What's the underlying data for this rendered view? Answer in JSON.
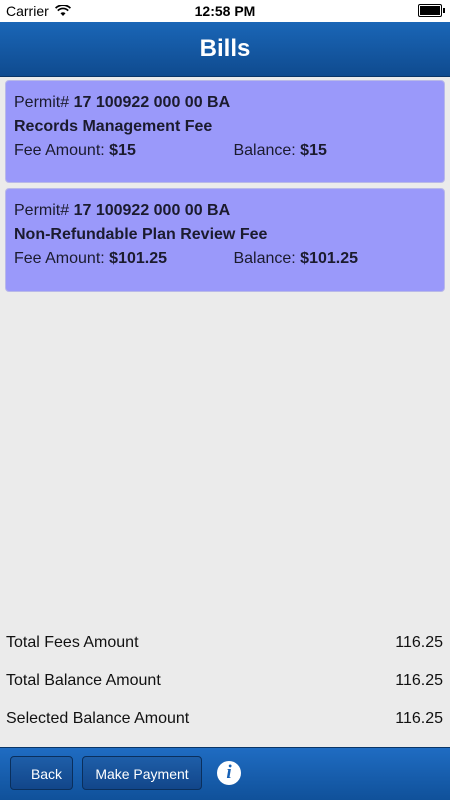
{
  "status_bar": {
    "carrier": "Carrier",
    "time": "12:58 PM"
  },
  "header": {
    "title": "Bills"
  },
  "bills": [
    {
      "permit_label": "Permit#",
      "permit_number": "17 100922 000 00 BA",
      "description": "Records Management Fee",
      "fee_label": "Fee Amount:",
      "fee_amount": "$15",
      "balance_label": "Balance:",
      "balance": "$15"
    },
    {
      "permit_label": "Permit#",
      "permit_number": "17 100922 000 00 BA",
      "description": "Non-Refundable Plan Review Fee",
      "fee_label": "Fee Amount:",
      "fee_amount": "$101.25",
      "balance_label": "Balance:",
      "balance": "$101.25"
    }
  ],
  "totals": [
    {
      "label": "Total Fees Amount",
      "value": "116.25"
    },
    {
      "label": "Total Balance Amount",
      "value": "116.25"
    },
    {
      "label": "Selected Balance Amount",
      "value": "116.25"
    }
  ],
  "toolbar": {
    "back_label": "Back",
    "pay_label": "Make Payment",
    "info_glyph": "i"
  },
  "colors": {
    "header_blue": "#1a66b7",
    "card_purple": "#9a99fa",
    "background": "#ebebeb"
  }
}
